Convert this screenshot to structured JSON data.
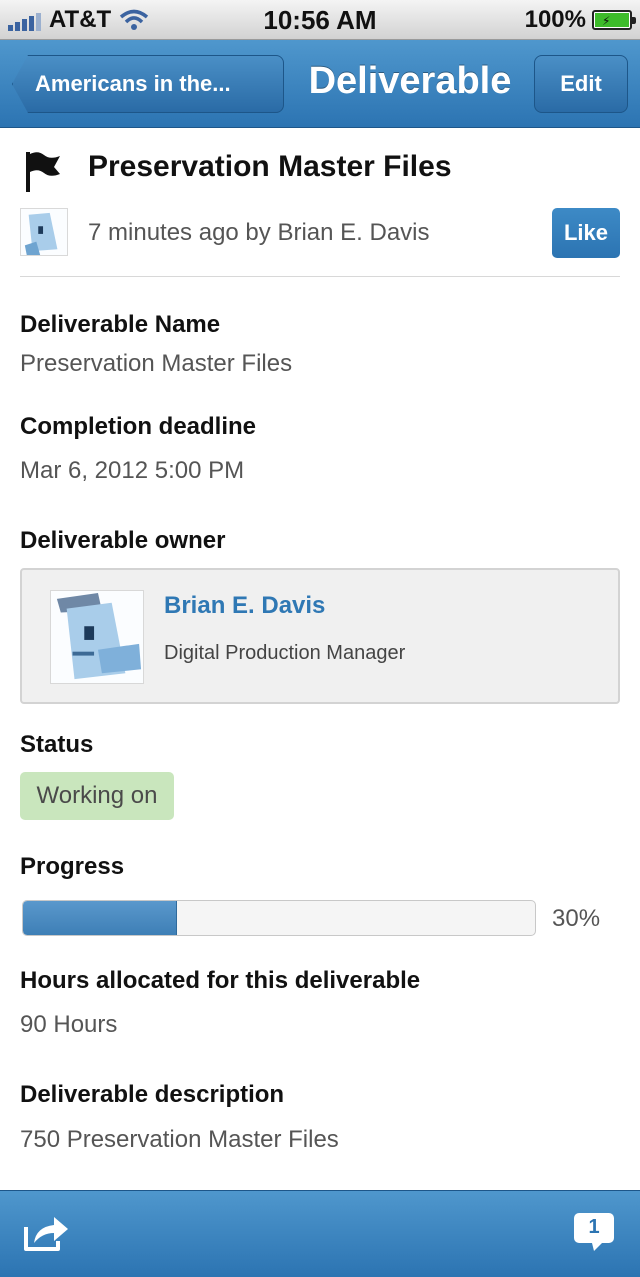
{
  "status_bar": {
    "carrier": "AT&T",
    "time": "10:56 AM",
    "battery": "100%"
  },
  "nav": {
    "back_label": "Americans in the...",
    "title": "Deliverable",
    "edit_label": "Edit"
  },
  "header": {
    "title": "Preservation Master Files",
    "meta": "7 minutes ago by Brian E. Davis",
    "like_label": "Like"
  },
  "fields": {
    "name_label": "Deliverable Name",
    "name_value": "Preservation Master Files",
    "deadline_label": "Completion deadline",
    "deadline_value": "Mar 6, 2012 5:00 PM",
    "owner_label": "Deliverable owner",
    "owner_name": "Brian E. Davis",
    "owner_role": "Digital Production Manager",
    "status_label": "Status",
    "status_value": "Working on",
    "progress_label": "Progress",
    "progress_text": "30%",
    "progress_fraction": 0.3,
    "hours_label": "Hours allocated for this deliverable",
    "hours_value": "90 Hours",
    "description_label": "Deliverable description",
    "description_value": "750 Preservation Master Files"
  },
  "toolbar": {
    "comment_count": "1"
  },
  "colors": {
    "accent": "#2c74b2",
    "status_green": "#c9e6bd",
    "link_blue": "#2f78b4"
  },
  "icons": {
    "flag": "flag-icon",
    "share": "share-icon",
    "comment": "comment-icon",
    "wifi": "wifi-icon",
    "battery": "battery-icon",
    "signal": "signal-icon"
  }
}
